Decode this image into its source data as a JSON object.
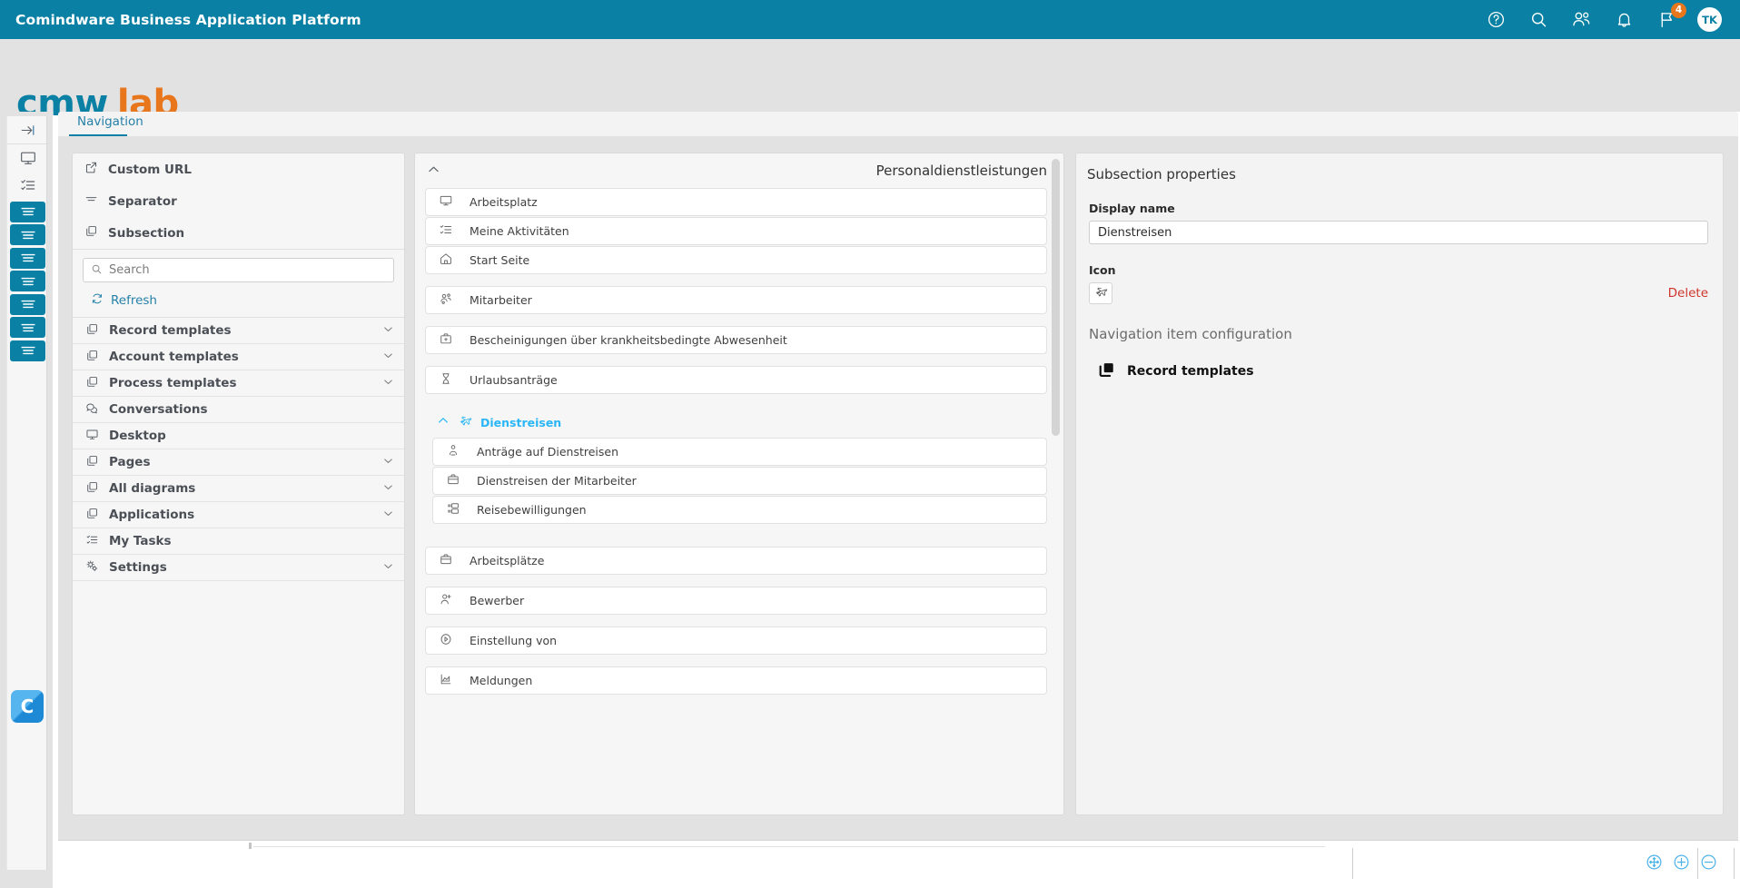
{
  "topbar": {
    "title": "Comindware Business Application Platform",
    "icons": [
      {
        "name": "help-icon",
        "glyph": "?"
      },
      {
        "name": "search-icon",
        "glyph": "search"
      },
      {
        "name": "people-icon",
        "glyph": "people"
      },
      {
        "name": "notifications-bell-icon",
        "glyph": "bell"
      },
      {
        "name": "flag-icon",
        "glyph": "flag",
        "badge": "4"
      }
    ],
    "badge_count": "4",
    "avatar_initials": "TK",
    "background_color": "#0a81a4",
    "badge_color": "#e8761d"
  },
  "logo": {
    "part1": "cmw",
    "part2": "lab",
    "color1": "#0a81a4",
    "color2": "#e8761d"
  },
  "rail": {
    "expand_label": "expand-panel",
    "items": [
      {
        "name": "expand-arrow-icon"
      },
      {
        "name": "desktop-monitor-icon"
      },
      {
        "name": "task-list-icon"
      }
    ],
    "tile_count": 7,
    "tile_color": "#0a81a4",
    "app_icon_letter": "C"
  },
  "tabs": [
    {
      "label": "Navigation",
      "active": true
    }
  ],
  "left_panel": {
    "top_items": [
      {
        "label": "Custom URL",
        "icon": "external-link-icon"
      },
      {
        "label": "Separator",
        "icon": "separator-icon"
      },
      {
        "label": "Subsection",
        "icon": "copy-icon"
      }
    ],
    "search": {
      "placeholder": "Search",
      "value": ""
    },
    "refresh_label": "Refresh",
    "nav_items": [
      {
        "label": "Record templates",
        "icon": "copy-icon",
        "expandable": true
      },
      {
        "label": "Account templates",
        "icon": "copy-icon",
        "expandable": true
      },
      {
        "label": "Process templates",
        "icon": "copy-icon",
        "expandable": true
      },
      {
        "label": "Conversations",
        "icon": "conversations-icon",
        "expandable": false
      },
      {
        "label": "Desktop",
        "icon": "desktop-monitor-icon",
        "expandable": false
      },
      {
        "label": "Pages",
        "icon": "copy-icon",
        "expandable": true
      },
      {
        "label": "All diagrams",
        "icon": "copy-icon",
        "expandable": true
      },
      {
        "label": "Applications",
        "icon": "copy-icon",
        "expandable": true
      },
      {
        "label": "My Tasks",
        "icon": "task-list-icon",
        "expandable": false
      },
      {
        "label": "Settings",
        "icon": "gears-icon",
        "expandable": true
      }
    ]
  },
  "center_panel": {
    "title": "Personaldienstleistungen",
    "collapse_icon": "chevron-up-icon",
    "items": [
      {
        "type": "item",
        "label": "Arbeitsplatz",
        "icon": "desktop-monitor-icon"
      },
      {
        "type": "item",
        "label": "Meine Aktivitäten",
        "icon": "task-list-icon"
      },
      {
        "type": "item",
        "label": "Start Seite",
        "icon": "home-icon"
      },
      {
        "type": "gap"
      },
      {
        "type": "item",
        "label": "Mitarbeiter",
        "icon": "people-group-icon"
      },
      {
        "type": "gap"
      },
      {
        "type": "item",
        "label": "Bescheinigungen über krankheitsbedingte Abwesenheit",
        "icon": "medical-case-icon"
      },
      {
        "type": "gap"
      },
      {
        "type": "item",
        "label": "Urlaubsanträge",
        "icon": "hourglass-icon"
      },
      {
        "type": "gap"
      },
      {
        "type": "group",
        "label": "Dienstreisen",
        "icon": "airplane-icon",
        "expanded": true,
        "color": "#29b6f6"
      },
      {
        "type": "item",
        "label": "Anträge auf Dienstreisen",
        "icon": "person-badge-icon",
        "indent": true
      },
      {
        "type": "item",
        "label": "Dienstreisen der Mitarbeiter",
        "icon": "briefcase-icon",
        "indent": true
      },
      {
        "type": "item",
        "label": "Reisebewilligungen",
        "icon": "list-card-icon",
        "indent": true
      },
      {
        "type": "gap"
      },
      {
        "type": "item",
        "label": "Arbeitsplätze",
        "icon": "briefcase-icon"
      },
      {
        "type": "gap"
      },
      {
        "type": "item",
        "label": "Bewerber",
        "icon": "person-add-icon"
      },
      {
        "type": "gap"
      },
      {
        "type": "item",
        "label": "Einstellung von",
        "icon": "play-circle-icon"
      },
      {
        "type": "gap"
      },
      {
        "type": "item",
        "label": "Meldungen",
        "icon": "chart-icon"
      }
    ]
  },
  "right_panel": {
    "title": "Subsection properties",
    "display_name_label": "Display name",
    "display_name_value": "Dienstreisen",
    "icon_label": "Icon",
    "selected_icon": "airplane-icon",
    "delete_label": "Delete",
    "delete_color": "#d0342c",
    "config_title": "Navigation item configuration",
    "config_item": {
      "label": "Record templates",
      "icon": "copy-filled-icon"
    }
  },
  "bottom_bar": {
    "zoom_controls": [
      {
        "name": "fit-to-screen-icon"
      },
      {
        "name": "zoom-in-icon"
      },
      {
        "name": "zoom-out-icon"
      }
    ],
    "control_color": "#4db3ea"
  }
}
